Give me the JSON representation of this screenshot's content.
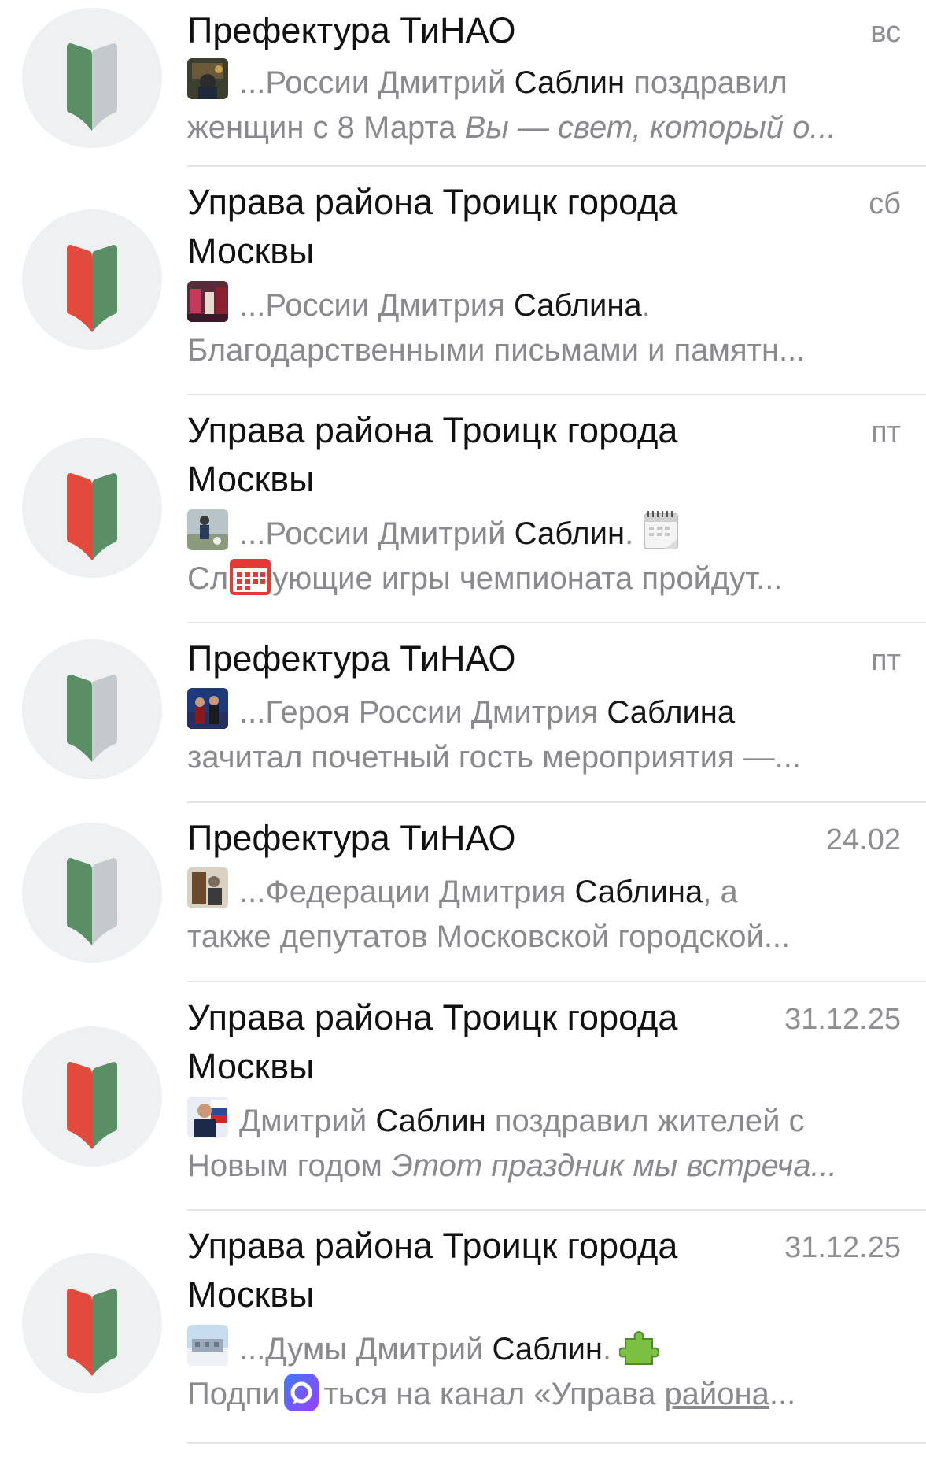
{
  "chats": [
    {
      "title": "Префектура ТиНАО",
      "date": "вс",
      "avatar_icon": "book-green-grey-icon",
      "thumb_icon": "photo-thumbnail-icon",
      "line1": {
        "a": "...России Дмитрий ",
        "b": "Саблин",
        "c": " поздравил"
      },
      "line2": {
        "a": "женщин с 8 Марта ",
        "b": "Вы — свет, который о..."
      }
    },
    {
      "title": "Управа района Троицк города\nМосквы",
      "date": "сб",
      "avatar_icon": "book-red-green-icon",
      "thumb_icon": "photo-thumbnail-icon",
      "line1": {
        "a": "...России Дмитрия ",
        "b": "Саблина",
        "c": "."
      },
      "line2": {
        "a": "Благодарственными письмами и памятн..."
      }
    },
    {
      "title": "Управа района Троицк города\nМосквы",
      "date": "пт",
      "avatar_icon": "book-red-green-icon",
      "thumb_icon": "photo-thumbnail-icon",
      "line1": {
        "a": "...России Дмитрий ",
        "b": "Саблин",
        "c": ".",
        "emoji": "tear-off-calendar-icon"
      },
      "line2": {
        "a": "Сл",
        "emoji": "calendar-icon",
        "b": "ующие игры чемпионата пройдут..."
      }
    },
    {
      "title": "Префектура ТиНАО",
      "date": "пт",
      "avatar_icon": "book-green-grey-icon",
      "thumb_icon": "photo-thumbnail-icon",
      "line1": {
        "a": "...Героя России Дмитрия ",
        "b": "Саблина",
        "c": ""
      },
      "line2": {
        "a": "зачитал почетный гость мероприятия —..."
      }
    },
    {
      "title": "Префектура ТиНАО",
      "date": "24.02",
      "avatar_icon": "book-green-grey-icon",
      "thumb_icon": "photo-thumbnail-icon",
      "line1": {
        "a": "...Федерации Дмитрия ",
        "b": "Саблина",
        "c": ", а"
      },
      "line2": {
        "a": "также депутатов Московской городской..."
      }
    },
    {
      "title": "Управа района Троицк города\nМосквы",
      "date": "31.12.25",
      "avatar_icon": "book-red-green-icon",
      "thumb_icon": "photo-thumbnail-icon",
      "line1": {
        "a": "Дмитрий ",
        "b": "Саблин",
        "c": " поздравил жителей с"
      },
      "line2": {
        "a": "Новым годом ",
        "b": "Этот праздник мы встреча..."
      }
    },
    {
      "title": "Управа района Троицк города\nМосквы",
      "date": "31.12.25",
      "avatar_icon": "book-red-green-icon",
      "thumb_icon": "photo-thumbnail-icon",
      "line1": {
        "a": "...Думы Дмитрий ",
        "b": "Саблин",
        "c": ".",
        "emoji": "puzzle-piece-icon"
      },
      "line2": {
        "a": "Подпи",
        "emoji": "max-messenger-icon",
        "b": "ться на канал «Управа ",
        "c": "района",
        "d": "..."
      }
    }
  ],
  "colors": {
    "book_green": "#5a8f66",
    "book_grey": "#c4c9ce",
    "book_red": "#e24a3b",
    "avatar_bg": "#eef0f1",
    "divider": "#e3e3e6"
  }
}
